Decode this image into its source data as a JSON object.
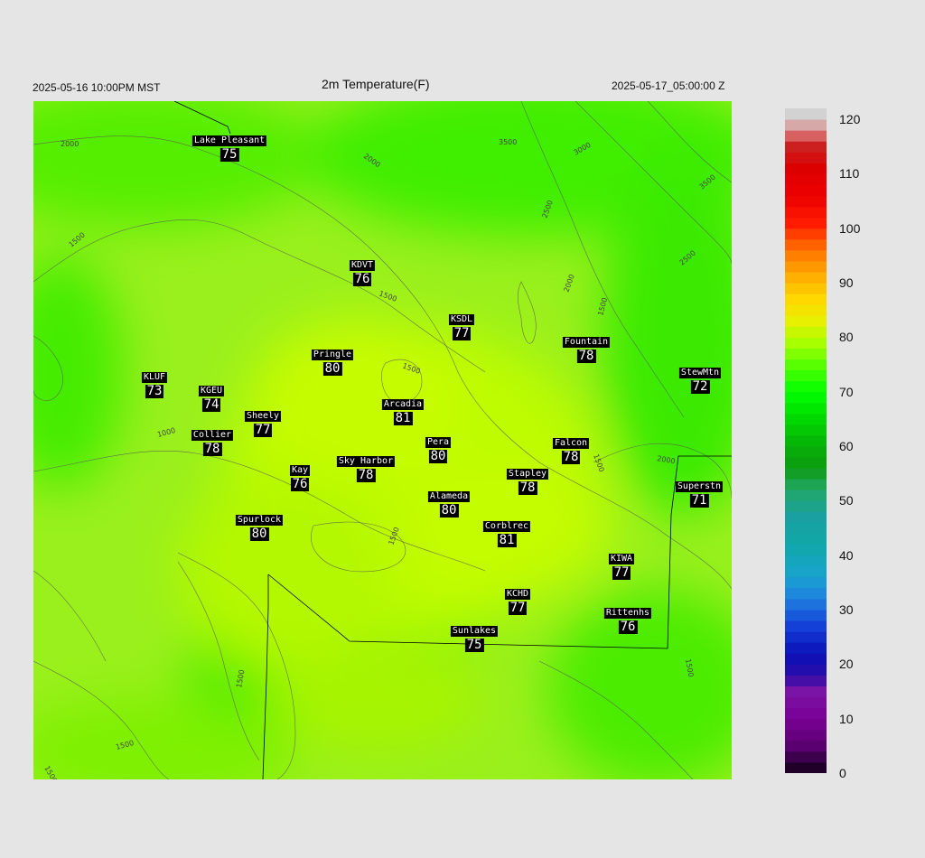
{
  "header": {
    "local_time": "2025-05-16 10:00PM MST",
    "title": "2m Temperature(F)",
    "utc_time": "2025-05-17_05:00:00 Z"
  },
  "stations": [
    {
      "name": "Lake Pleasant",
      "value": "75"
    },
    {
      "name": "KDVT",
      "value": "76"
    },
    {
      "name": "KSDL",
      "value": "77"
    },
    {
      "name": "Fountain",
      "value": "78"
    },
    {
      "name": "Pringle",
      "value": "80"
    },
    {
      "name": "KLUF",
      "value": "73"
    },
    {
      "name": "KGEU",
      "value": "74"
    },
    {
      "name": "StewMtn",
      "value": "72"
    },
    {
      "name": "Arcadia",
      "value": "81"
    },
    {
      "name": "Sheely",
      "value": "77"
    },
    {
      "name": "Collier",
      "value": "78"
    },
    {
      "name": "Pera",
      "value": "80"
    },
    {
      "name": "Falcon",
      "value": "78"
    },
    {
      "name": "Kay",
      "value": "76"
    },
    {
      "name": "Sky Harbor",
      "value": "78"
    },
    {
      "name": "Stapley",
      "value": "78"
    },
    {
      "name": "Superstn",
      "value": "71"
    },
    {
      "name": "Alameda",
      "value": "80"
    },
    {
      "name": "Spurlock",
      "value": "80"
    },
    {
      "name": "Corblrec",
      "value": "81"
    },
    {
      "name": "KIWA",
      "value": "77"
    },
    {
      "name": "KCHD",
      "value": "77"
    },
    {
      "name": "Rittenhs",
      "value": "76"
    },
    {
      "name": "Sunlakes",
      "value": "75"
    }
  ],
  "contour_labels": [
    "2000",
    "2000",
    "3500",
    "3000",
    "3500",
    "2500",
    "2000",
    "2500",
    "1500",
    "1500",
    "1500",
    "1000",
    "1500",
    "2000",
    "1500",
    "1500",
    "1500",
    "1500",
    "1500",
    "1500",
    "1500"
  ],
  "colorbar": {
    "ticks": [
      "120",
      "110",
      "100",
      "90",
      "80",
      "70",
      "60",
      "50",
      "40",
      "30",
      "20",
      "10",
      "0"
    ],
    "range": [
      0,
      122
    ]
  }
}
